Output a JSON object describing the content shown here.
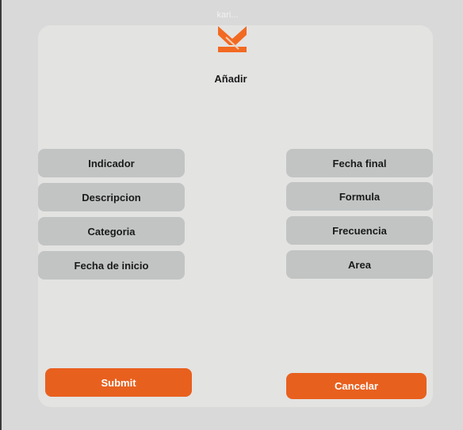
{
  "window": {
    "top_label": "kari..."
  },
  "logo": {
    "icon": "brand-logo-icon",
    "color": "#f26a21"
  },
  "form": {
    "title": "Añadir",
    "left_fields": [
      "Indicador",
      "Descripcion",
      "Categoria",
      "Fecha de inicio"
    ],
    "right_fields": [
      "Fecha final",
      "Formula",
      "Frecuencia",
      "Area"
    ]
  },
  "actions": {
    "submit_label": "Submit",
    "cancel_label": "Cancelar"
  },
  "colors": {
    "accent": "#e8601e",
    "field_bg": "#c2c4c4",
    "card_bg": "#e3e3e2",
    "page_bg": "#d9d9d9"
  }
}
